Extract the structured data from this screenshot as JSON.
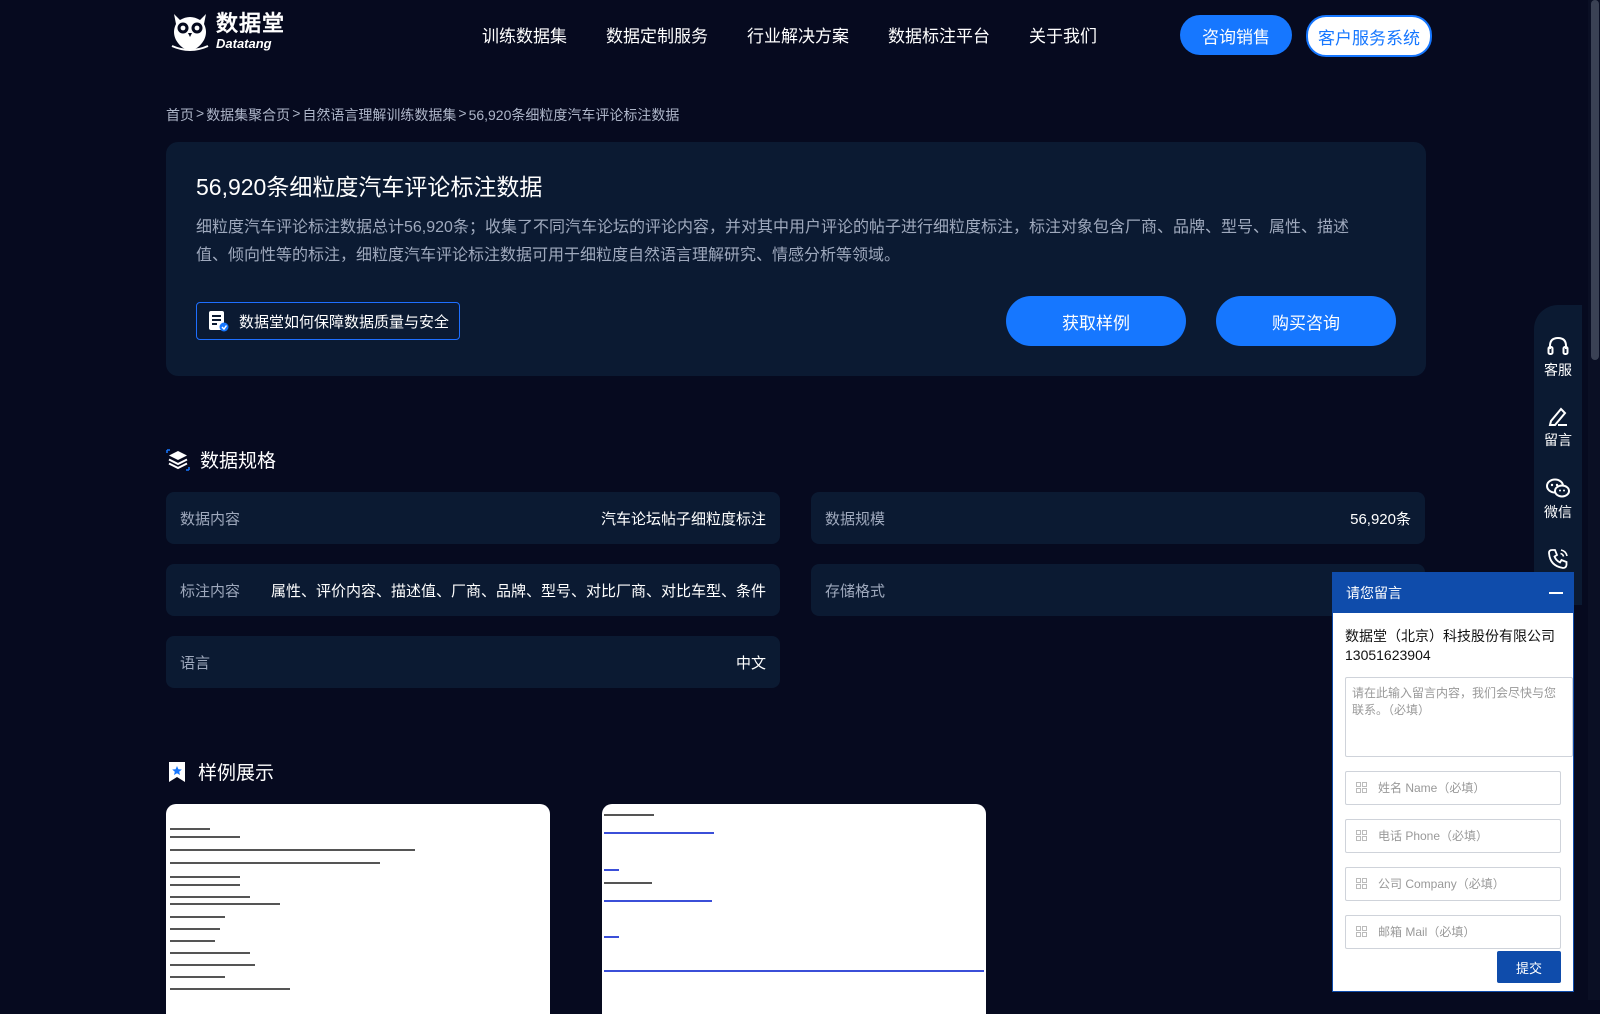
{
  "logo": {
    "cn": "数据堂",
    "en": "Datatang"
  },
  "nav": [
    "训练数据集",
    "数据定制服务",
    "行业解决方案",
    "数据标注平台",
    "关于我们"
  ],
  "header_buttons": {
    "sales": "咨询销售",
    "customer_service": "客户服务系统"
  },
  "breadcrumb": {
    "items": [
      "首页",
      "数据集聚合页",
      "自然语言理解训练数据集",
      "56,920条细粒度汽车评论标注数据"
    ],
    "separator": ">"
  },
  "hero": {
    "title": "56,920条细粒度汽车评论标注数据",
    "description": "细粒度汽车评论标注数据总计56,920条；收集了不同汽车论坛的评论内容，并对其中用户评论的帖子进行细粒度标注，标注对象包含厂商、品牌、型号、属性、描述值、倾向性等的标注，细粒度汽车评论标注数据可用于细粒度自然语言理解研究、情感分析等领域。",
    "quality_link": "数据堂如何保障数据质量与安全",
    "sample_button": "获取样例",
    "buy_button": "购买咨询"
  },
  "spec_section": {
    "title": "数据规格",
    "items": [
      {
        "label": "数据内容",
        "value": "汽车论坛帖子细粒度标注"
      },
      {
        "label": "数据规模",
        "value": "56,920条"
      },
      {
        "label": "标注内容",
        "value": "属性、评价内容、描述值、厂商、品牌、型号、对比厂商、对比车型、条件"
      },
      {
        "label": "存储格式",
        "value": ""
      },
      {
        "label": "语言",
        "value": "中文"
      }
    ]
  },
  "sample_section": {
    "title": "样例展示"
  },
  "sidebar": {
    "items": [
      "客服",
      "留言",
      "微信"
    ]
  },
  "message_widget": {
    "title": "请您留言",
    "company": "数据堂（北京）科技股份有限公司",
    "phone": "13051623904",
    "textarea_placeholder": "请在此输入留言内容，我们会尽快与您联系。（必填）",
    "fields": [
      "姓名 Name（必填）",
      "电话 Phone（必填）",
      "公司 Company（必填）",
      "邮箱 Mail（必填）"
    ],
    "submit": "提交"
  },
  "colors": {
    "background": "#060a1f",
    "card": "#0b1a32",
    "accent": "#1677ff",
    "widget_blue": "#0f4cab"
  }
}
